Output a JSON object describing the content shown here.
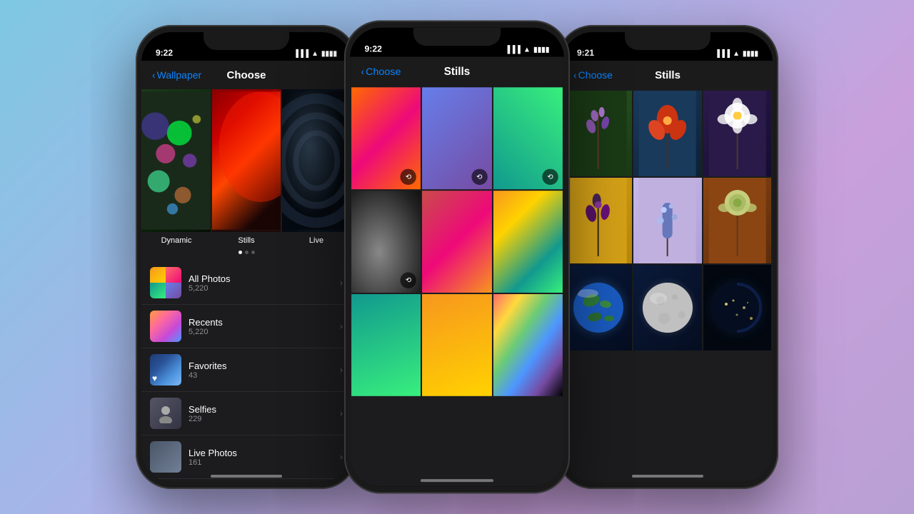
{
  "background": {
    "gradient": "linear-gradient(135deg, #7ec8e3 0%, #a8b4e8 40%, #c9a0dc 70%, #b8a0d4 100%)"
  },
  "phone1": {
    "time": "9:22",
    "nav_back": "Wallpaper",
    "nav_title": "Choose",
    "categories": [
      "Dynamic",
      "Stills",
      "Live"
    ],
    "albums": [
      {
        "name": "All Photos",
        "count": "5,220"
      },
      {
        "name": "Recents",
        "count": "5,220"
      },
      {
        "name": "Favorites",
        "count": "43"
      },
      {
        "name": "Selfies",
        "count": "229"
      },
      {
        "name": "Live Photos",
        "count": "161"
      }
    ]
  },
  "phone2": {
    "time": "9:22",
    "nav_back": "Choose",
    "nav_title": "Stills"
  },
  "phone3": {
    "time": "9:21",
    "nav_back": "Choose",
    "nav_title": "Stills"
  }
}
